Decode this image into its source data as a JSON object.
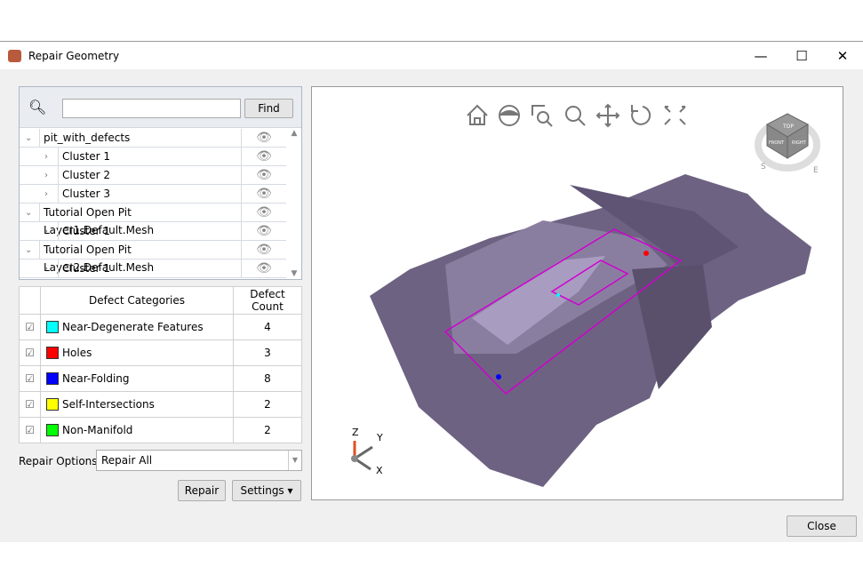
{
  "window": {
    "title": "Repair Geometry",
    "minimize": "—",
    "maximize": "☐",
    "close": "✕"
  },
  "search": {
    "value": "",
    "find_label": "Find"
  },
  "tree": [
    {
      "label": "pit_with_defects",
      "level": 0
    },
    {
      "label": "Cluster 1",
      "level": 1
    },
    {
      "label": "Cluster 2",
      "level": 1
    },
    {
      "label": "Cluster 3",
      "level": 1
    },
    {
      "label": "Tutorial Open Pit Layer1.Default.Mesh",
      "level": 0
    },
    {
      "label": "Cluster 1",
      "level": 1
    },
    {
      "label": "Tutorial Open Pit Layer2.Default.Mesh",
      "level": 0
    },
    {
      "label": "Cluster 1",
      "level": 1
    }
  ],
  "defects": {
    "headers": [
      "Defect Categories",
      "Defect Count"
    ],
    "rows": [
      {
        "name": "Near-Degenerate Features",
        "count": "4",
        "color": "#00ffff",
        "checked": true
      },
      {
        "name": "Holes",
        "count": "3",
        "color": "#ff0000",
        "checked": true
      },
      {
        "name": "Near-Folding",
        "count": "8",
        "color": "#0000ff",
        "checked": true
      },
      {
        "name": "Self-Intersections",
        "count": "2",
        "color": "#ffff00",
        "checked": true
      },
      {
        "name": "Non-Manifold",
        "count": "2",
        "color": "#00ff00",
        "checked": true
      }
    ]
  },
  "repair_options": {
    "label": "Repair Options:",
    "value": "Repair All"
  },
  "buttons": {
    "repair": "Repair",
    "settings": "Settings ▾",
    "close": "Close"
  },
  "viewport": {
    "toolbar": [
      "home-icon",
      "eye-icon",
      "zoom-window-icon",
      "zoom-icon",
      "pan-icon",
      "rotate-icon",
      "fit-icon"
    ],
    "viewcube": {
      "top": "TOP",
      "front": "FRONT",
      "right": "RIGHT",
      "compass": [
        "S",
        "E"
      ]
    },
    "axes": {
      "z": "Z",
      "y": "Y",
      "x": "X"
    },
    "mesh_color": "#6e6282",
    "box_color": "#d000d0"
  }
}
